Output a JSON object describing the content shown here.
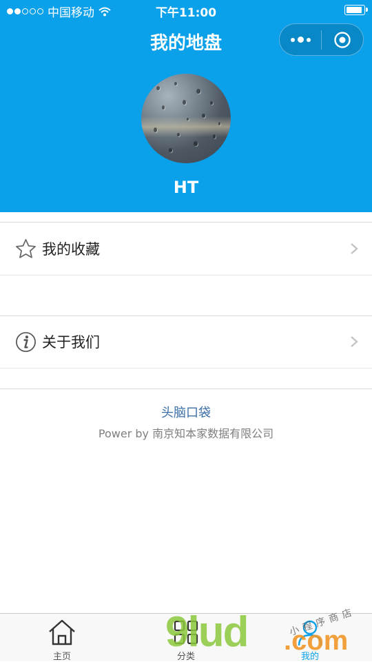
{
  "status_bar": {
    "carrier": "中国移动",
    "time": "下午11:00",
    "battery_level": 0.85
  },
  "header": {
    "title": "我的地盘",
    "username": "HT",
    "capsule_icons": [
      "more-icon",
      "target-icon"
    ]
  },
  "menu": [
    {
      "label": "我的收藏",
      "icon": "star-icon"
    },
    {
      "label": "关于我们",
      "icon": "info-icon"
    }
  ],
  "footer": {
    "link": "头脑口袋",
    "power": "Power by 南京知本家数据有限公司"
  },
  "tabbar": [
    {
      "label": "主页",
      "icon": "home-icon",
      "active": false
    },
    {
      "label": "分类",
      "icon": "grid-icon",
      "active": false
    },
    {
      "label": "我的",
      "icon": "user-icon",
      "active": true
    }
  ],
  "watermark": {
    "brand": "9lud",
    "domain": ".com",
    "tagline": "小程序商店"
  },
  "colors": {
    "primary": "#0aa0ea",
    "link": "#3b6ea8"
  }
}
